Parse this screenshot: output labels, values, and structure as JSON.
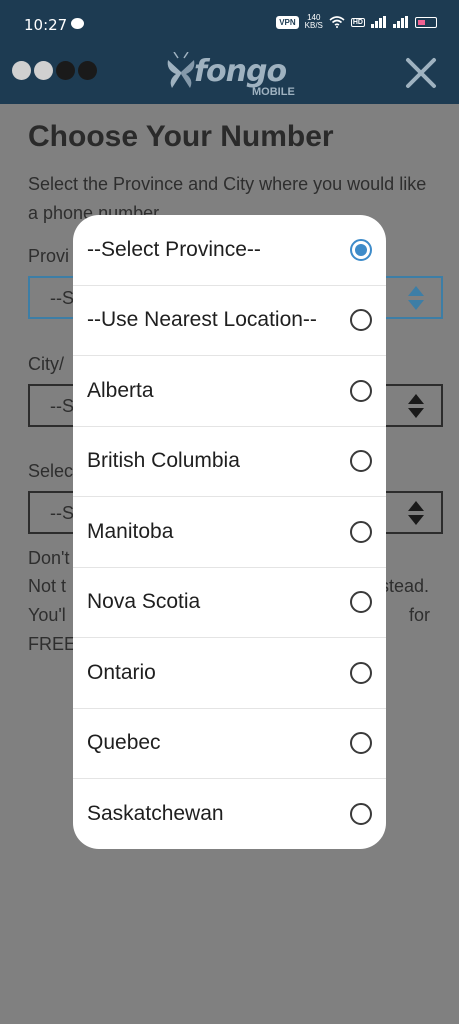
{
  "status_bar": {
    "time": "10:27",
    "vpn": "VPN",
    "speed_value": "140",
    "speed_unit": "KB/S",
    "hd": "HD",
    "net1": "4G",
    "net2": "4G"
  },
  "header": {
    "logo_text": "fongo",
    "logo_sub": "MOBILE",
    "dot_colors": [
      "#d0d0d0",
      "#d0d0d0",
      "#1a1a1a",
      "#1a1a1a"
    ]
  },
  "page": {
    "title": "Choose Your Number",
    "subtitle": "Select the Province and City where you would like a phone number",
    "province_label": "Provi",
    "province_value": "--S",
    "city_label": "City/",
    "city_value": "--S",
    "third_label": "Selec",
    "third_value": "--S",
    "info_line1": "Don't",
    "info_line2_start": "Not t",
    "info_line2_end": "stead.",
    "info_line3_start": "You'l",
    "info_line3_end": "for",
    "info_line4": "FREE"
  },
  "province_picker": {
    "selected_index": 0,
    "options": [
      {
        "label": "--Select Province--"
      },
      {
        "label": "--Use Nearest Location--"
      },
      {
        "label": "Alberta"
      },
      {
        "label": "British Columbia"
      },
      {
        "label": "Manitoba"
      },
      {
        "label": "Nova Scotia"
      },
      {
        "label": "Ontario"
      },
      {
        "label": "Quebec"
      },
      {
        "label": "Saskatchewan"
      }
    ]
  },
  "colors": {
    "header_bg": "#1d3b52",
    "accent": "#3d8bc9",
    "overlay": "#808080"
  }
}
